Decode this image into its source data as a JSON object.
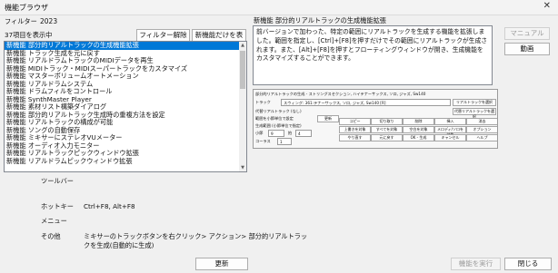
{
  "window": {
    "title": "機能ブラウザ",
    "close_glyph": "✕"
  },
  "filter": {
    "label": "フィルター",
    "value": "2023"
  },
  "count_label": "37項目を表示中",
  "buttons": {
    "clear_filter": "フィルター解除",
    "show_new_only": "新機能だけを表示",
    "manual": "マニュアル",
    "video": "動画",
    "update": "更新",
    "run": "機能を実行",
    "close": "閉じる"
  },
  "features": [
    "新機能 部分的リアルトラックの生成機能拡張",
    "新機能 トラック生成を元に戻す",
    "新機能 リアルドラムトラックのMIDIデータを再生",
    "新機能 MIDIトラック・MIDIスーパートラックをカスタマイズ",
    "新機能 マスターボリュームオートメーション",
    "新機能 リアルドラムシステム",
    "新機能 ドラムフィルをコントロール",
    "新機能 SynthMaster Player",
    "新機能 素材リスト構築ダイアログ",
    "新機能 部分的リアルトラック生成時の重複方法を設定",
    "新機能 リアルトラックの構成が可能",
    "新機能 ソングの自動保存",
    "新機能 ミキサーにステレオVUメーター",
    "新機能 オーディオ入力モニター",
    "新機能 リアルトラックピックウィンドウ拡張",
    "新機能 リアルドラムピックウィンドウ拡張"
  ],
  "selected_index": 0,
  "detail": {
    "title": "新機能 部分的リアルトラックの生成機能拡張",
    "description": "前バージョンで加わった、特定の範囲にリアルトラックを生成する機能を拡張しました。範囲を指定し、[Ctrl]+[F8]を押すだけでその範囲にリアルトラックが生成されます。また、[Alt]+[F8]を押すとフローティングウィンドウが開き、生成機能をカスタマイズすることができます。"
  },
  "screenshot": {
    "title": "部分的リアルトラックの生成 - ストリングスセクション, ハイテナーサックス, ソロ, ジャズ, Sw140",
    "track_label": "トラック",
    "track_value": "スウィング: 361:テナーサックス, ソロ, ジャズ, Sw140 [R]",
    "select_rt": "リアルトラックを選択",
    "alt_label": "代替リアルトラック (なし)",
    "alt_select": "代替リアルトラックを選択",
    "checkbox": "範囲を小節単位で設定",
    "update": "更新",
    "range_label": "生成範囲 (小節単位で指定)",
    "bar": "小節",
    "bar_val": "9",
    "beat": "拍",
    "beat_val": "4",
    "chorus": "コーラス",
    "chorus_val": "1",
    "grid": [
      "コピー",
      "切り取り",
      "削除",
      "挿入",
      "消去",
      "上書きを対象",
      "すべてを対象",
      "空白を対象",
      "メロディ/ソロを対象",
      "オプション",
      "やり直す",
      "元に戻す",
      "OK - 生成",
      "キャンセル",
      "ヘルプ"
    ]
  },
  "info": {
    "toolbar_label": "ツールバー",
    "hotkey_label": "ホットキー",
    "hotkey_value": "Ctrl+F8, Alt+F8",
    "menu_label": "メニュー",
    "other_label": "その他",
    "other_value_1": "ミキサーのトラックボタンを右クリック> アクション> 部分的リアルトラッ",
    "other_value_2": "クを生成(自動的に生成)"
  }
}
